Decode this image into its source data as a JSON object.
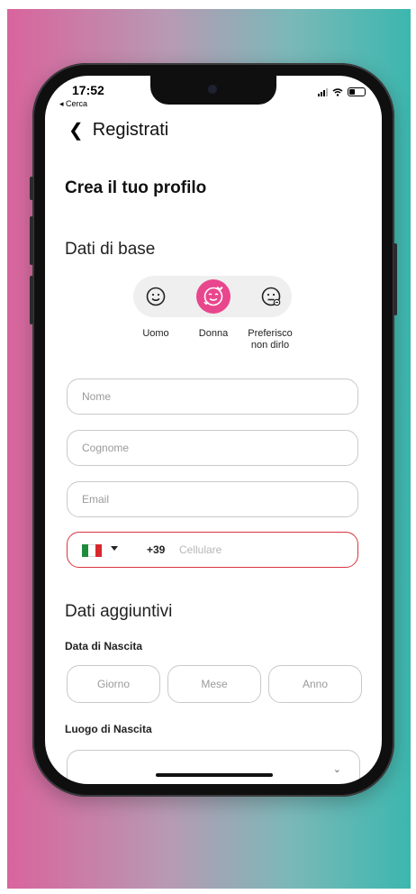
{
  "status_bar": {
    "time": "17:52",
    "back_app": "◂ Cerca"
  },
  "header": {
    "back_icon": "chevron-left-icon",
    "title": "Registrati"
  },
  "page": {
    "heading": "Crea il tuo profilo"
  },
  "basic": {
    "section_title": "Dati di base",
    "gender_options": [
      {
        "label": "Uomo",
        "icon": "smile-face-icon",
        "selected": false
      },
      {
        "label": "Donna",
        "icon": "hearts-face-icon",
        "selected": true
      },
      {
        "label": "Preferisco non dirlo",
        "label_line1": "Preferisco",
        "label_line2": "non dirlo",
        "icon": "neutral-face-icon",
        "selected": false
      }
    ],
    "name_placeholder": "Nome",
    "surname_placeholder": "Cognome",
    "email_placeholder": "Email",
    "phone": {
      "country_flag": "italy-flag-icon",
      "prefix": "+39",
      "placeholder": "Cellulare"
    }
  },
  "additional": {
    "section_title": "Dati aggiuntivi",
    "birth_date_label": "Data di Nascita",
    "day_placeholder": "Giorno",
    "month_placeholder": "Mese",
    "year_placeholder": "Anno",
    "birth_place_label": "Luogo di Nascita"
  },
  "colors": {
    "accent": "#e8468d",
    "error_border": "#d9333f",
    "gradient_left": "#d9649d",
    "gradient_right": "#3cb7ae"
  }
}
